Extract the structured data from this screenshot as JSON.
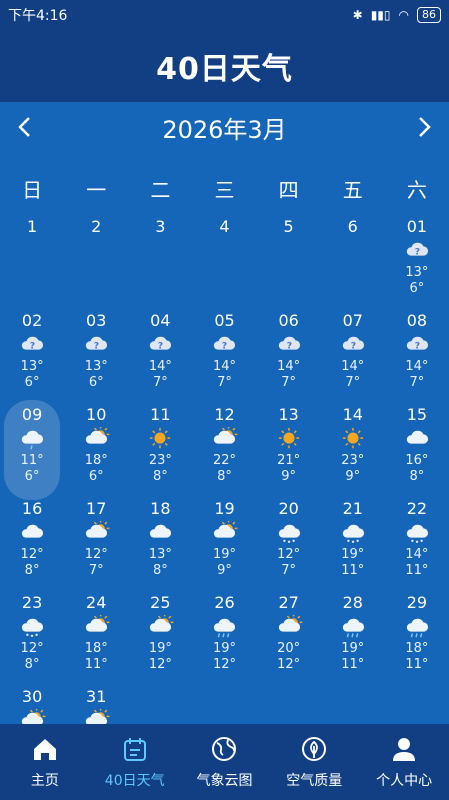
{
  "status": {
    "time": "下午4:16",
    "battery": "86"
  },
  "header": {
    "title": "40日天气"
  },
  "month": {
    "title": "2026年3月"
  },
  "weekdays": [
    "日",
    "一",
    "二",
    "三",
    "四",
    "五",
    "六"
  ],
  "first_row": [
    "1",
    "2",
    "3",
    "4",
    "5",
    "6"
  ],
  "days": [
    {
      "date": "01",
      "icon": "unknown",
      "high": "13°",
      "low": "6°"
    },
    {
      "date": "02",
      "icon": "unknown",
      "high": "13°",
      "low": "6°"
    },
    {
      "date": "03",
      "icon": "unknown",
      "high": "13°",
      "low": "6°"
    },
    {
      "date": "04",
      "icon": "unknown",
      "high": "14°",
      "low": "7°"
    },
    {
      "date": "05",
      "icon": "unknown",
      "high": "14°",
      "low": "7°"
    },
    {
      "date": "06",
      "icon": "unknown",
      "high": "14°",
      "low": "7°"
    },
    {
      "date": "07",
      "icon": "unknown",
      "high": "14°",
      "low": "7°"
    },
    {
      "date": "08",
      "icon": "unknown",
      "high": "14°",
      "low": "7°"
    },
    {
      "date": "09",
      "icon": "light-rain",
      "high": "11°",
      "low": "6°",
      "selected": true
    },
    {
      "date": "10",
      "icon": "partly-cloudy",
      "high": "18°",
      "low": "6°"
    },
    {
      "date": "11",
      "icon": "sunny",
      "high": "23°",
      "low": "8°"
    },
    {
      "date": "12",
      "icon": "partly-cloudy",
      "high": "22°",
      "low": "8°"
    },
    {
      "date": "13",
      "icon": "sunny",
      "high": "21°",
      "low": "9°"
    },
    {
      "date": "14",
      "icon": "sunny",
      "high": "23°",
      "low": "9°"
    },
    {
      "date": "15",
      "icon": "cloudy",
      "high": "16°",
      "low": "8°"
    },
    {
      "date": "16",
      "icon": "cloudy",
      "high": "12°",
      "low": "8°"
    },
    {
      "date": "17",
      "icon": "partly-cloudy",
      "high": "12°",
      "low": "7°"
    },
    {
      "date": "18",
      "icon": "cloudy",
      "high": "13°",
      "low": "8°"
    },
    {
      "date": "19",
      "icon": "partly-cloudy",
      "high": "19°",
      "low": "9°"
    },
    {
      "date": "20",
      "icon": "sleet",
      "high": "12°",
      "low": "7°"
    },
    {
      "date": "21",
      "icon": "sleet",
      "high": "19°",
      "low": "11°"
    },
    {
      "date": "22",
      "icon": "sleet",
      "high": "14°",
      "low": "11°"
    },
    {
      "date": "23",
      "icon": "sleet",
      "high": "12°",
      "low": "8°"
    },
    {
      "date": "24",
      "icon": "partly-cloudy",
      "high": "18°",
      "low": "11°"
    },
    {
      "date": "25",
      "icon": "partly-cloudy",
      "high": "19°",
      "low": "12°"
    },
    {
      "date": "26",
      "icon": "rain",
      "high": "19°",
      "low": "12°"
    },
    {
      "date": "27",
      "icon": "partly-cloudy",
      "high": "20°",
      "low": "12°"
    },
    {
      "date": "28",
      "icon": "rain",
      "high": "19°",
      "low": "11°"
    },
    {
      "date": "29",
      "icon": "rain",
      "high": "18°",
      "low": "11°"
    },
    {
      "date": "30",
      "icon": "partly-cloudy",
      "high": "",
      "low": ""
    },
    {
      "date": "31",
      "icon": "partly-cloudy",
      "high": "",
      "low": ""
    }
  ],
  "nav": [
    {
      "label": "主页",
      "icon": "home-icon",
      "active": false
    },
    {
      "label": "40日天气",
      "icon": "calendar-icon",
      "active": true
    },
    {
      "label": "气象云图",
      "icon": "globe-icon",
      "active": false
    },
    {
      "label": "空气质量",
      "icon": "leaf-icon",
      "active": false
    },
    {
      "label": "个人中心",
      "icon": "user-icon",
      "active": false
    }
  ],
  "colors": {
    "background": "#1565b8",
    "header": "#123f83",
    "active_nav": "#5ec8ff"
  }
}
